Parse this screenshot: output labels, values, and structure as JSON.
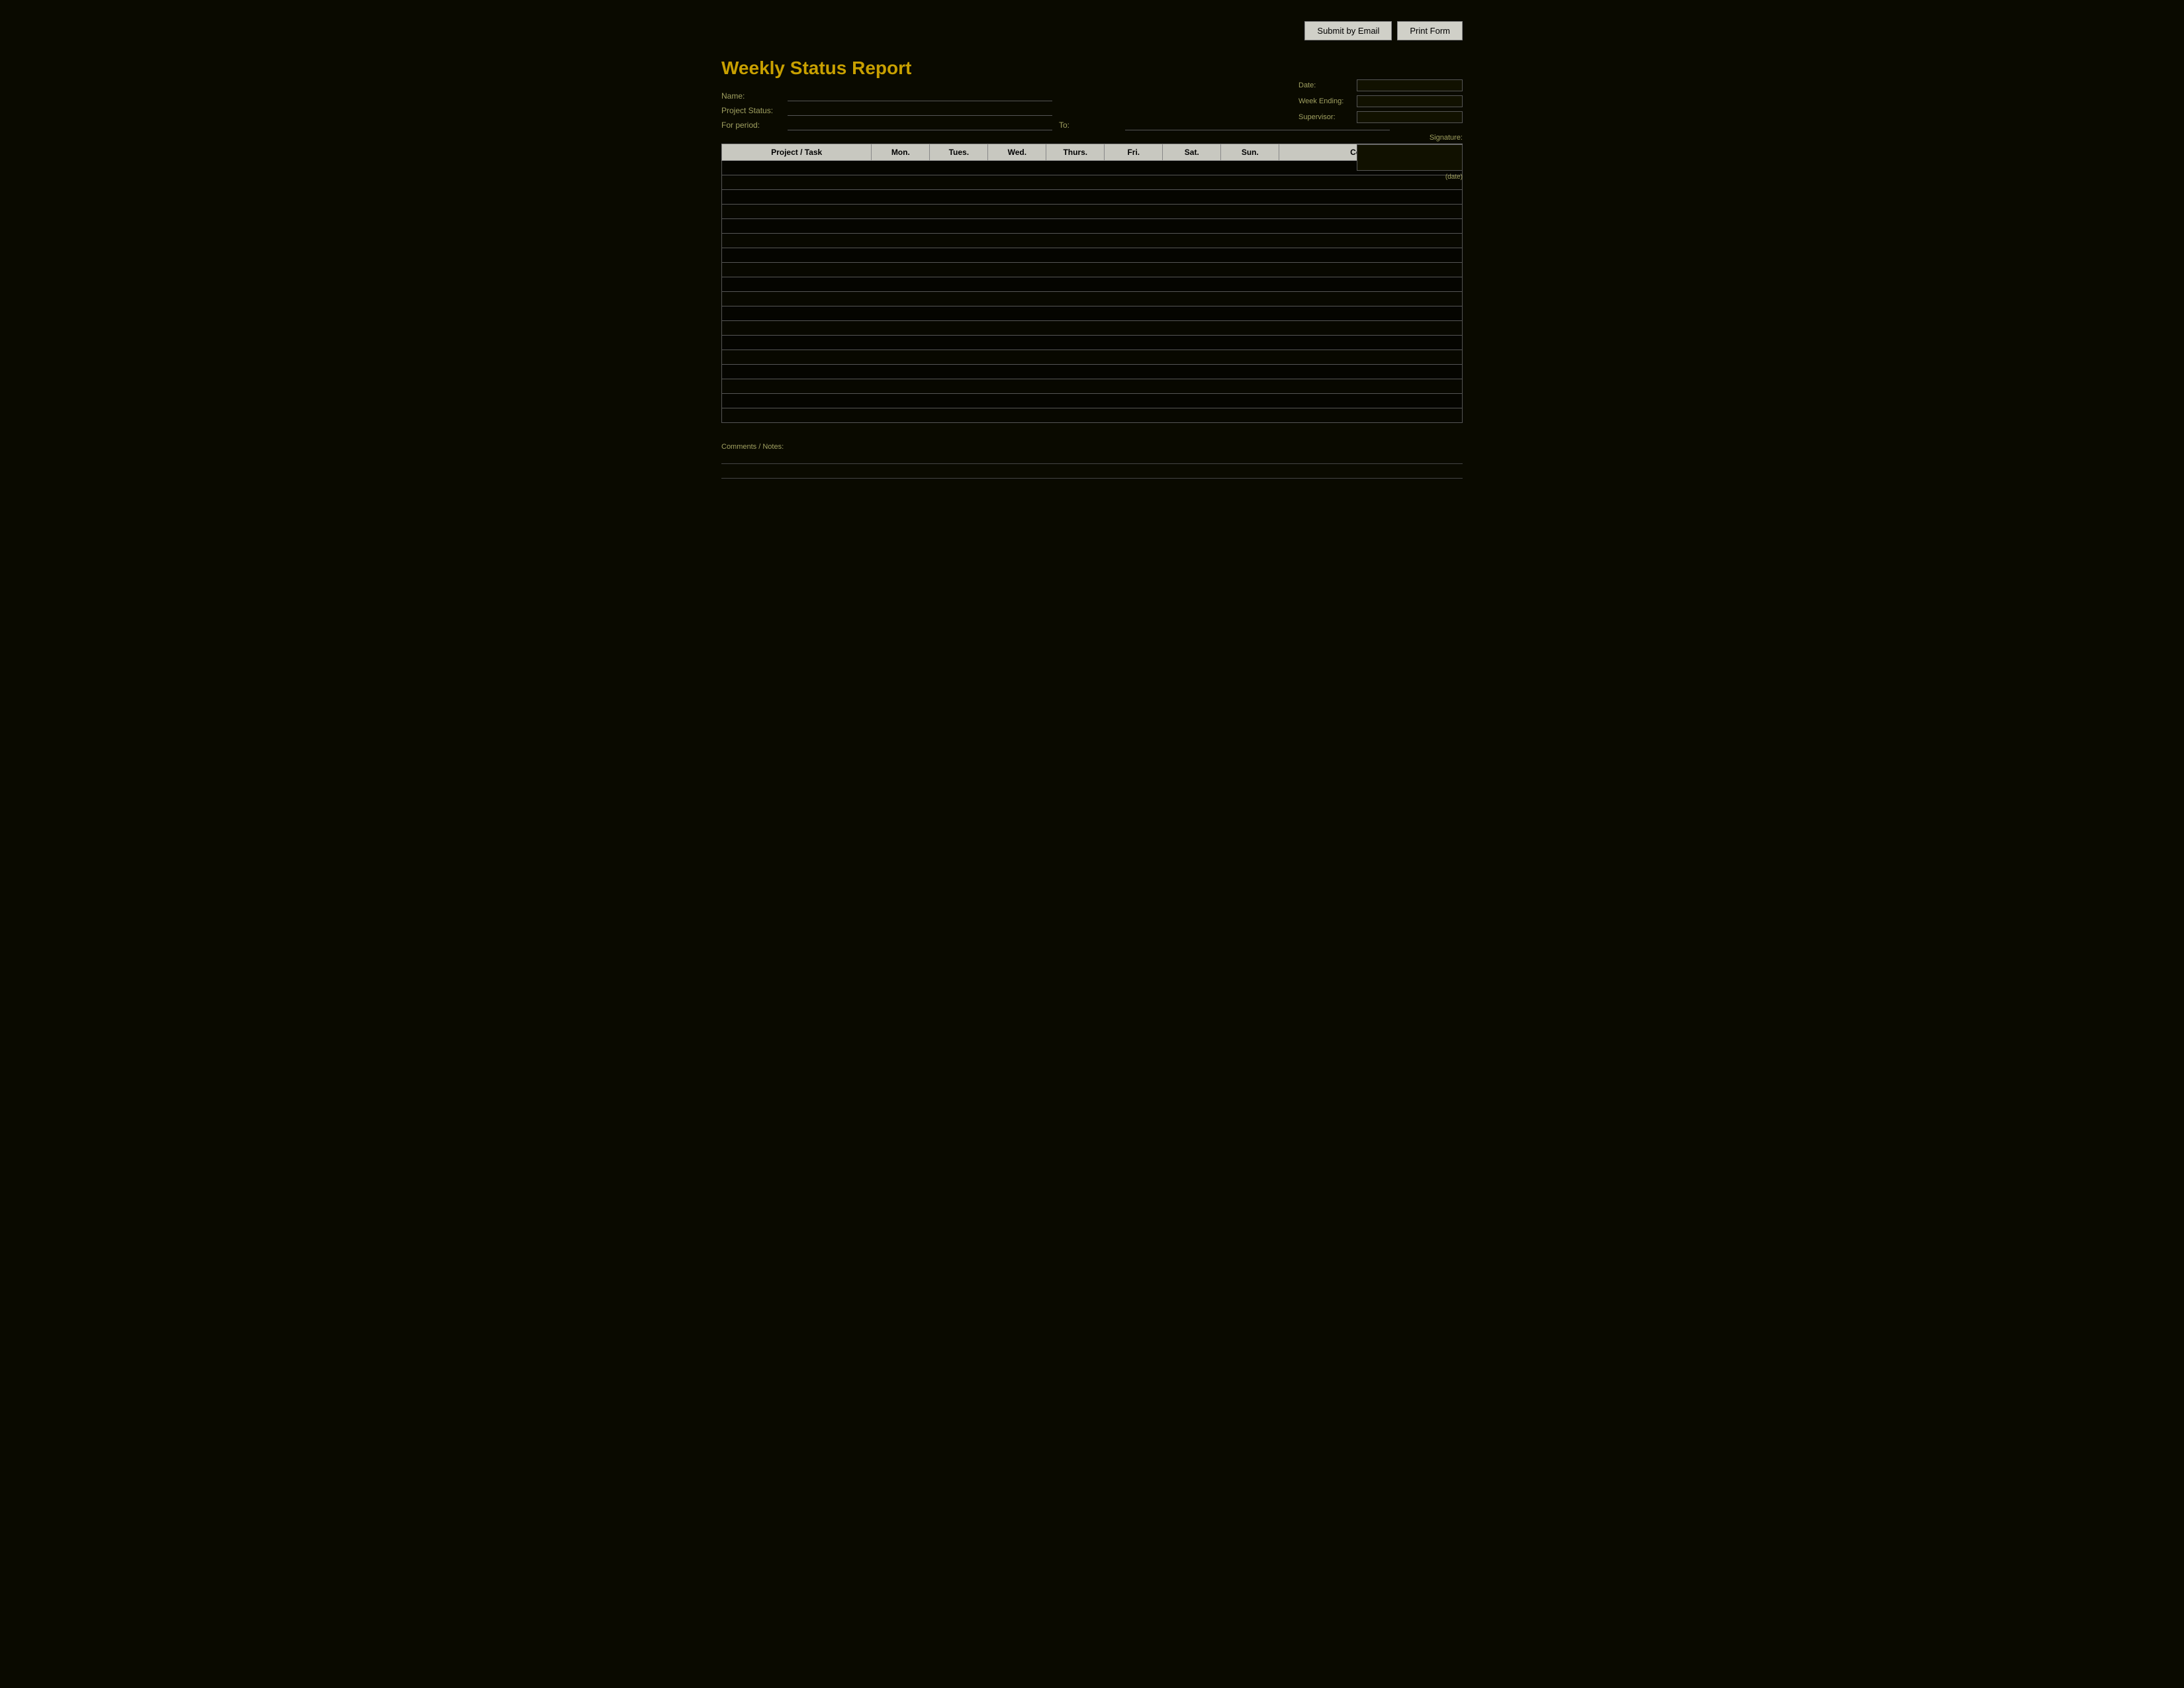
{
  "toolbar": {
    "submit_email_label": "Submit by Email",
    "print_form_label": "Print Form"
  },
  "header": {
    "title": "Weekly Status Report"
  },
  "form": {
    "name_label": "Name:",
    "project_status_label": "Project Status:",
    "for_period_label": "For period:",
    "to_label": "To:",
    "date_label": "Date:",
    "week_ending_label": "Week Ending:",
    "supervisor_label": "Supervisor:",
    "signature_label": "Signature:",
    "signature_date_label": "(date)"
  },
  "table": {
    "headers": [
      "Project / Task",
      "Mon.",
      "Tues.",
      "Wed.",
      "Thurs.",
      "Fri.",
      "Sat.",
      "Sun.",
      "Comments"
    ],
    "row_count": 18
  },
  "footer": {
    "notes_label": "Comments / Notes:"
  }
}
